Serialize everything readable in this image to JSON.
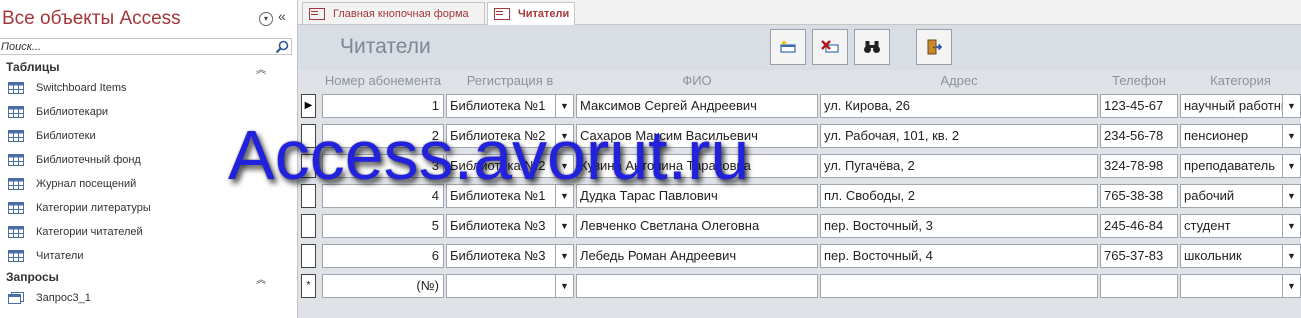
{
  "nav": {
    "title": "Все объекты Access",
    "search_placeholder": "Поиск...",
    "groups": [
      {
        "label": "Таблицы",
        "items": [
          "Switchboard Items",
          "Библиотекари",
          "Библиотеки",
          "Библиотечный фонд",
          "Журнал посещений",
          "Категории литературы",
          "Категории читателей",
          "Читатели"
        ]
      },
      {
        "label": "Запросы",
        "items": [
          "Запрос3_1"
        ]
      }
    ]
  },
  "tabs": [
    {
      "label": "Главная кнопочная форма"
    },
    {
      "label": "Читатели"
    }
  ],
  "form": {
    "title": "Читатели",
    "columns": [
      "Номер абонемента",
      "Регистрация в",
      "ФИО",
      "Адрес",
      "Телефон",
      "Категория"
    ],
    "rows": [
      {
        "id": "1",
        "lib": "Библиотека №1",
        "fio": "Максимов Сергей Андреевич",
        "addr": "ул. Кирова, 26",
        "phone": "123-45-67",
        "cat": "научный работник"
      },
      {
        "id": "2",
        "lib": "Библиотека №2",
        "fio": "Сахаров Максим Васильевич",
        "addr": "ул. Рабочая, 101, кв. 2",
        "phone": "234-56-78",
        "cat": "пенсионер"
      },
      {
        "id": "3",
        "lib": "Библиотека №2",
        "fio": "Кузина Антонина Тарасовна",
        "addr": "ул. Пугачёва, 2",
        "phone": "324-78-98",
        "cat": "преподаватель"
      },
      {
        "id": "4",
        "lib": "Библиотека №1",
        "fio": "Дудка Тарас Павлович",
        "addr": "пл. Свободы, 2",
        "phone": "765-38-38",
        "cat": "рабочий"
      },
      {
        "id": "5",
        "lib": "Библиотека №3",
        "fio": "Левченко Светлана Олеговна",
        "addr": "пер. Восточный, 3",
        "phone": "245-46-84",
        "cat": "студент"
      },
      {
        "id": "6",
        "lib": "Библиотека №3",
        "fio": "Лебедь Роман Андреевич",
        "addr": "пер. Восточный, 4",
        "phone": "765-37-83",
        "cat": "школьник"
      }
    ],
    "new_row_id": "(№)",
    "current_marker": "▶",
    "new_marker": "*"
  },
  "watermark": "Access.avorut.ru",
  "colors": {
    "accent": "#a4373a",
    "form_bg": "#dfe3e8",
    "watermark": "#2222dd"
  }
}
